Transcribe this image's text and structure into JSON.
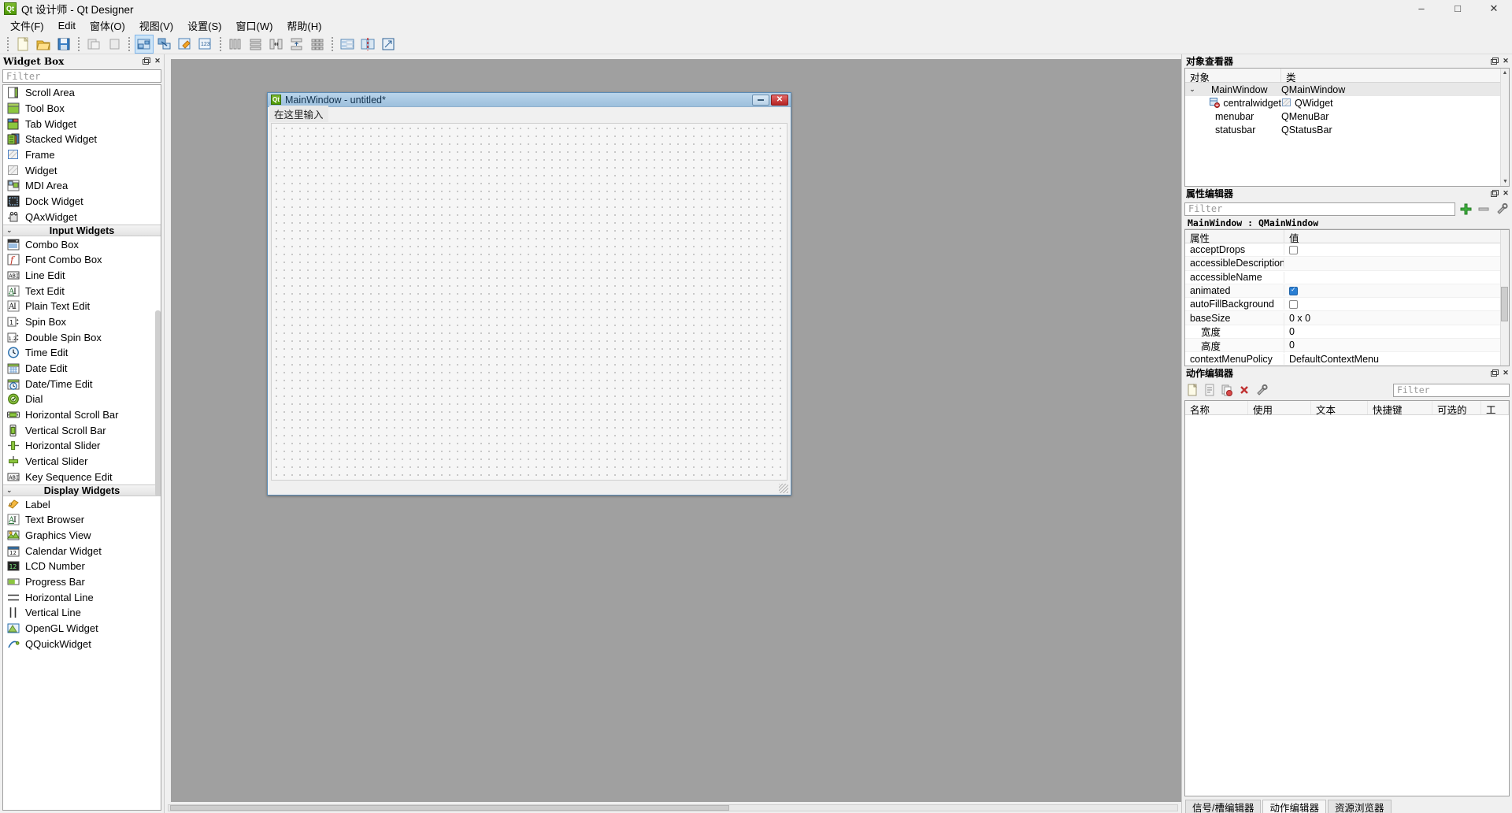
{
  "window": {
    "title": "Qt 设计师 - Qt Designer",
    "app_icon": "Qt",
    "minimize": "–",
    "maximize": "□",
    "close": "✕"
  },
  "menubar": {
    "items": [
      {
        "label": "文件(F)",
        "name": "menu-file"
      },
      {
        "label": "Edit",
        "name": "menu-edit"
      },
      {
        "label": "窗体(O)",
        "name": "menu-form"
      },
      {
        "label": "视图(V)",
        "name": "menu-view"
      },
      {
        "label": "设置(S)",
        "name": "menu-settings"
      },
      {
        "label": "窗口(W)",
        "name": "menu-window"
      },
      {
        "label": "帮助(H)",
        "name": "menu-help"
      }
    ]
  },
  "toolbar": {
    "groups": [
      [
        "new-file-icon",
        "open-file-icon",
        "save-file-icon"
      ],
      [
        "undo-icon",
        "redo-icon"
      ],
      [
        "edit-widgets-icon",
        "edit-signals-slots-icon",
        "edit-buddies-icon",
        "edit-tab-order-icon"
      ],
      [
        "layout-horizontal-icon",
        "layout-vertical-icon",
        "layout-splitter-horizontal-icon",
        "layout-splitter-vertical-icon",
        "layout-grid-icon"
      ],
      [
        "layout-form-icon",
        "break-layout-icon",
        "adjust-size-icon"
      ]
    ]
  },
  "widget_box": {
    "title": "Widget Box",
    "filter_placeholder": "Filter",
    "float_btn": "float",
    "close_btn": "✕",
    "items": [
      {
        "label": "Scroll Area",
        "icon": "scroll-area-icon",
        "type": "item"
      },
      {
        "label": "Tool Box",
        "icon": "tool-box-icon",
        "type": "item"
      },
      {
        "label": "Tab Widget",
        "icon": "tab-widget-icon",
        "type": "item"
      },
      {
        "label": "Stacked Widget",
        "icon": "stacked-widget-icon",
        "type": "item"
      },
      {
        "label": "Frame",
        "icon": "frame-icon",
        "type": "item"
      },
      {
        "label": "Widget",
        "icon": "widget-icon",
        "type": "item"
      },
      {
        "label": "MDI Area",
        "icon": "mdi-area-icon",
        "type": "item"
      },
      {
        "label": "Dock Widget",
        "icon": "dock-widget-icon",
        "type": "item"
      },
      {
        "label": "QAxWidget",
        "icon": "qax-widget-icon",
        "type": "item"
      },
      {
        "label": "Input Widgets",
        "icon": "chevron-down-icon",
        "type": "section"
      },
      {
        "label": "Combo Box",
        "icon": "combo-box-icon",
        "type": "item"
      },
      {
        "label": "Font Combo Box",
        "icon": "font-combo-box-icon",
        "type": "item"
      },
      {
        "label": "Line Edit",
        "icon": "line-edit-icon",
        "type": "item"
      },
      {
        "label": "Text Edit",
        "icon": "text-edit-icon",
        "type": "item"
      },
      {
        "label": "Plain Text Edit",
        "icon": "plain-text-edit-icon",
        "type": "item"
      },
      {
        "label": "Spin Box",
        "icon": "spin-box-icon",
        "type": "item"
      },
      {
        "label": "Double Spin Box",
        "icon": "double-spin-box-icon",
        "type": "item"
      },
      {
        "label": "Time Edit",
        "icon": "time-edit-icon",
        "type": "item"
      },
      {
        "label": "Date Edit",
        "icon": "date-edit-icon",
        "type": "item"
      },
      {
        "label": "Date/Time Edit",
        "icon": "date-time-edit-icon",
        "type": "item"
      },
      {
        "label": "Dial",
        "icon": "dial-icon",
        "type": "item"
      },
      {
        "label": "Horizontal Scroll Bar",
        "icon": "horizontal-scroll-bar-icon",
        "type": "item"
      },
      {
        "label": "Vertical Scroll Bar",
        "icon": "vertical-scroll-bar-icon",
        "type": "item"
      },
      {
        "label": "Horizontal Slider",
        "icon": "horizontal-slider-icon",
        "type": "item"
      },
      {
        "label": "Vertical Slider",
        "icon": "vertical-slider-icon",
        "type": "item"
      },
      {
        "label": "Key Sequence Edit",
        "icon": "key-sequence-edit-icon",
        "type": "item"
      },
      {
        "label": "Display Widgets",
        "icon": "chevron-down-icon",
        "type": "section"
      },
      {
        "label": "Label",
        "icon": "label-icon",
        "type": "item"
      },
      {
        "label": "Text Browser",
        "icon": "text-browser-icon",
        "type": "item"
      },
      {
        "label": "Graphics View",
        "icon": "graphics-view-icon",
        "type": "item"
      },
      {
        "label": "Calendar Widget",
        "icon": "calendar-widget-icon",
        "type": "item"
      },
      {
        "label": "LCD Number",
        "icon": "lcd-number-icon",
        "type": "item"
      },
      {
        "label": "Progress Bar",
        "icon": "progress-bar-icon",
        "type": "item"
      },
      {
        "label": "Horizontal Line",
        "icon": "horizontal-line-icon",
        "type": "item"
      },
      {
        "label": "Vertical Line",
        "icon": "vertical-line-icon",
        "type": "item"
      },
      {
        "label": "OpenGL Widget",
        "icon": "opengl-widget-icon",
        "type": "item"
      },
      {
        "label": "QQuickWidget",
        "icon": "qquick-widget-icon",
        "type": "item"
      }
    ]
  },
  "form": {
    "title": "MainWindow - untitled*",
    "icon": "Qt",
    "menu_placeholder": "在这里输入",
    "minimize": "–",
    "close": "✕"
  },
  "object_inspector": {
    "title": "对象查看器",
    "float_btn": "float",
    "close_btn": "✕",
    "columns": [
      "对象",
      "类"
    ],
    "rows": [
      {
        "object": "MainWindow",
        "class": "QMainWindow",
        "indent": 0,
        "expandable": true,
        "icon": "main-window-icon"
      },
      {
        "object": "centralwidget",
        "class": "QWidget",
        "indent": 1,
        "expandable": false,
        "icon": "central-widget-icon"
      },
      {
        "object": "menubar",
        "class": "QMenuBar",
        "indent": 1,
        "expandable": false,
        "icon": ""
      },
      {
        "object": "statusbar",
        "class": "QStatusBar",
        "indent": 1,
        "expandable": false,
        "icon": ""
      }
    ]
  },
  "property_editor": {
    "title": "属性编辑器",
    "float_btn": "float",
    "close_btn": "✕",
    "filter_placeholder": "Filter",
    "object_line": "MainWindow : QMainWindow",
    "columns": [
      "属性",
      "值"
    ],
    "rows": [
      {
        "name": "acceptDrops",
        "value": "",
        "control": "checkbox",
        "checked": false,
        "indent": 0
      },
      {
        "name": "accessibleDescription",
        "value": "",
        "control": "text",
        "indent": 0
      },
      {
        "name": "accessibleName",
        "value": "",
        "control": "text",
        "indent": 0
      },
      {
        "name": "animated",
        "value": "",
        "control": "checkbox",
        "checked": true,
        "indent": 0
      },
      {
        "name": "autoFillBackground",
        "value": "",
        "control": "checkbox",
        "checked": false,
        "indent": 0
      },
      {
        "name": "baseSize",
        "value": "0 x 0",
        "control": "text",
        "indent": 0
      },
      {
        "name": "宽度",
        "value": "0",
        "control": "text",
        "indent": 1
      },
      {
        "name": "高度",
        "value": "0",
        "control": "text",
        "indent": 1
      },
      {
        "name": "contextMenuPolicy",
        "value": "DefaultContextMenu",
        "control": "text",
        "indent": 0
      }
    ],
    "toolbar_icons": [
      "add-property-icon",
      "remove-property-icon",
      "configure-icon"
    ]
  },
  "action_editor": {
    "title": "动作编辑器",
    "float_btn": "float",
    "close_btn": "✕",
    "filter_placeholder": "Filter",
    "toolbar_icons": [
      "new-action-icon",
      "edit-action-icon",
      "copy-action-icon",
      "delete-action-icon",
      "configure-icon"
    ],
    "columns": [
      "名称",
      "使用",
      "文本",
      "快捷键",
      "可选的",
      "工"
    ],
    "rows": []
  },
  "bottom_tabs": [
    {
      "label": "信号/槽编辑器",
      "active": false
    },
    {
      "label": "动作编辑器",
      "active": true
    },
    {
      "label": "资源浏览器",
      "active": false
    }
  ],
  "colors": {
    "accent": "#2a7fd4",
    "canvas": "#a0a0a0",
    "chrome": "#f0f0f0",
    "form_title_top": "#b9d4ea",
    "form_title_bottom": "#9dc0dd",
    "close_red": "#b52424",
    "qt_green": "#4e9a06"
  }
}
